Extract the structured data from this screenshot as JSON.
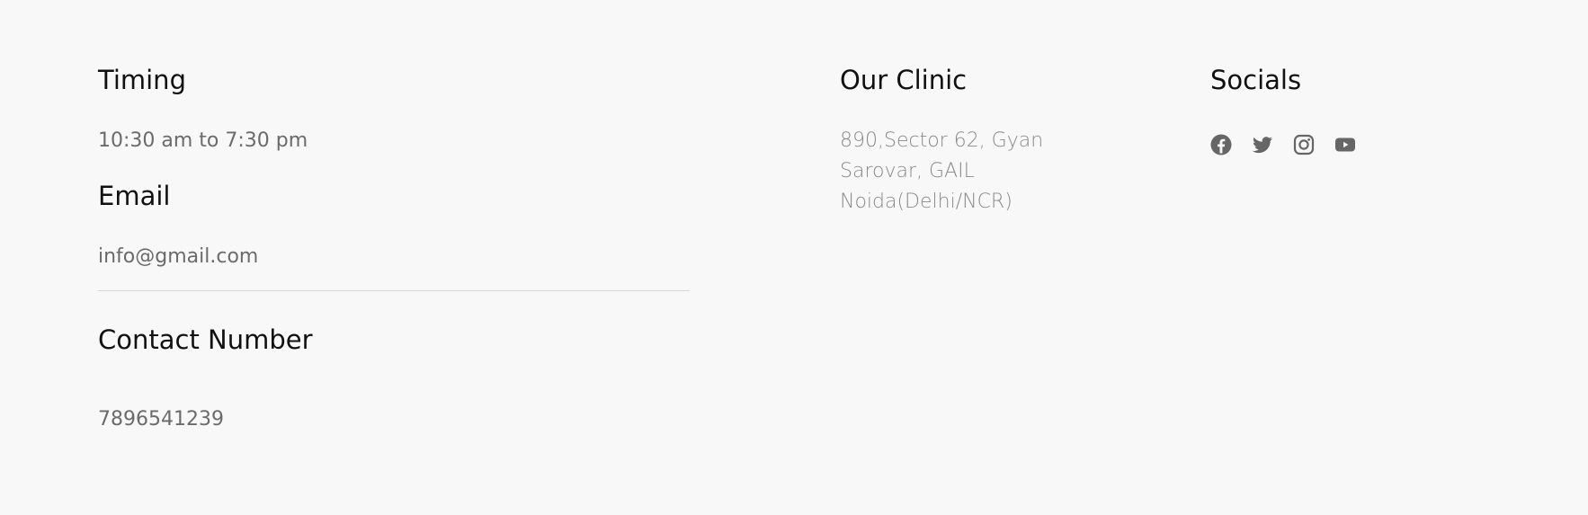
{
  "timing": {
    "heading": "Timing",
    "value": "10:30 am to 7:30 pm"
  },
  "email": {
    "heading": "Email",
    "value": "info@gmail.com"
  },
  "contact": {
    "heading": "Contact Number",
    "value": "7896541239"
  },
  "clinic": {
    "heading": "Our Clinic",
    "address_lines": [
      "890,Sector 62, Gyan",
      "Sarovar, GAIL",
      "Noida(Delhi/NCR)"
    ]
  },
  "socials": {
    "heading": "Socials",
    "icons": [
      "facebook-icon",
      "twitter-icon",
      "instagram-icon",
      "youtube-icon"
    ]
  },
  "colors": {
    "background": "#f8f8f8",
    "heading": "#111111",
    "text": "#6b6b6b",
    "address": "#8a8a8a",
    "icon": "#666666",
    "divider": "#d6d6d6"
  }
}
